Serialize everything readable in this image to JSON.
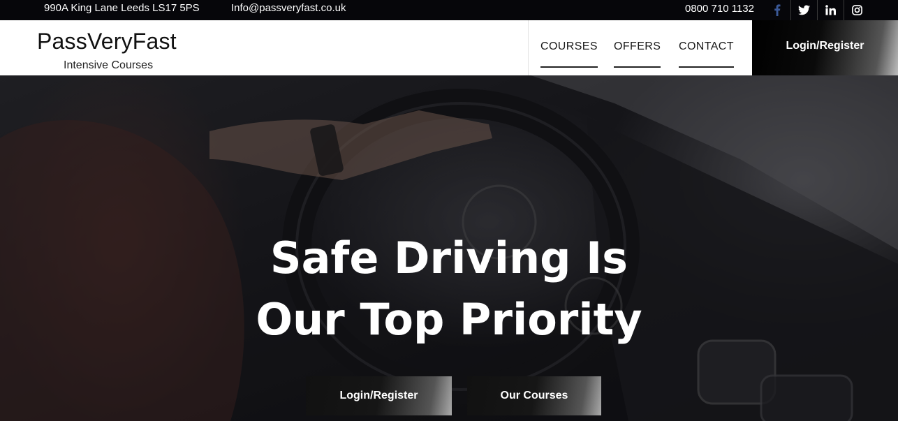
{
  "topbar": {
    "address": "990A King Lane Leeds LS17 5PS",
    "email": "Info@passveryfast.co.uk",
    "phone": "0800 710 1132",
    "social_icons": [
      "facebook-icon",
      "twitter-icon",
      "linkedin-icon",
      "instagram-icon"
    ]
  },
  "header": {
    "logo_title": "PassVeryFast",
    "logo_subtitle": "Intensive Courses",
    "nav": [
      {
        "label": "COURSES"
      },
      {
        "label": "OFFERS"
      },
      {
        "label": "CONTACT"
      }
    ],
    "login_label": "Login/Register"
  },
  "hero": {
    "title_line1": "Safe Driving Is",
    "title_line2": "Our Top Priority",
    "buttons": [
      {
        "label": "Login/Register"
      },
      {
        "label": "Our Courses"
      }
    ]
  },
  "colors": {
    "topbar_bg": "#06060a",
    "header_bg": "#ffffff",
    "facebook_blue": "#3b5998",
    "hero_text": "#ffffff"
  }
}
